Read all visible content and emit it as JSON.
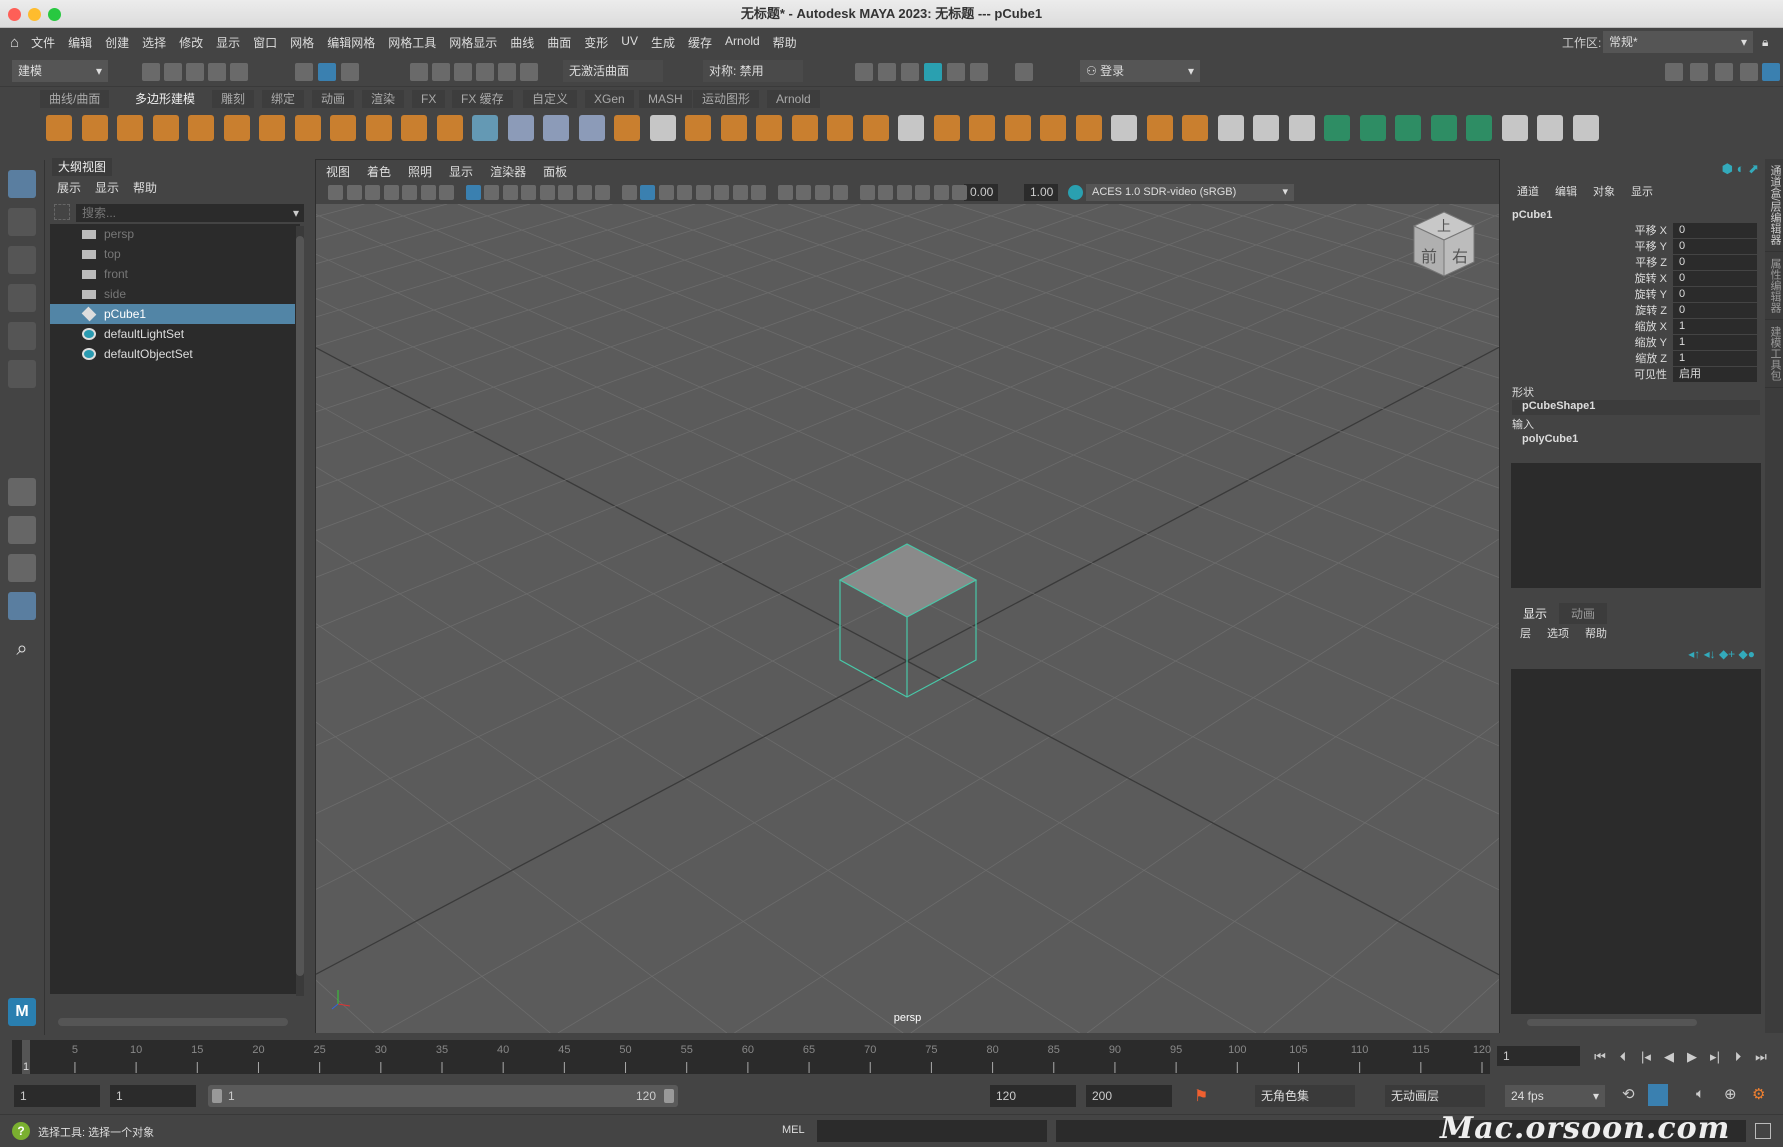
{
  "window": {
    "title": "无标题* - Autodesk MAYA 2023: 无标题   ---   pCube1"
  },
  "menubar": {
    "items": [
      "文件",
      "编辑",
      "创建",
      "选择",
      "修改",
      "显示",
      "窗口",
      "网格",
      "编辑网格",
      "网格工具",
      "网格显示",
      "曲线",
      "曲面",
      "变形",
      "UV",
      "生成",
      "缓存",
      "Arnold",
      "帮助"
    ],
    "workspace_label": "工作区:",
    "workspace_value": "常规*"
  },
  "toolbar": {
    "mode": "建模",
    "live_surface": "无激活曲面",
    "symmetry": "对称: 禁用",
    "login": "登录"
  },
  "shelf": {
    "tabs": [
      "曲线/曲面",
      "多边形建模",
      "雕刻",
      "绑定",
      "动画",
      "渲染",
      "FX",
      "FX 缓存",
      "自定义",
      "XGen",
      "MASH",
      "运动图形",
      "Arnold"
    ],
    "active_tab": 1,
    "icons": [
      [
        "poly-sphere-icon",
        "#e08a2c"
      ],
      [
        "poly-cube-icon",
        "#e08a2c"
      ],
      [
        "poly-cylinder-icon",
        "#e08a2c"
      ],
      [
        "poly-cone-icon",
        "#e08a2c"
      ],
      [
        "poly-torus-icon",
        "#e08a2c"
      ],
      [
        "poly-plane-icon",
        "#e08a2c"
      ],
      [
        "poly-disc-icon",
        "#e08a2c"
      ],
      [
        "platonic-icon",
        "#e08a2c"
      ],
      [
        "super-shape-icon",
        "#e08a2c"
      ],
      [
        "sweep-mesh-icon",
        "#e08a2c"
      ],
      [
        "text-icon",
        "#e08a2c"
      ],
      [
        "svg-icon",
        "#e08a2c"
      ],
      [
        "uv-editor-icon",
        "#6aa8c8"
      ],
      [
        "center-pivot-icon",
        "#9ac"
      ],
      [
        "delete-history-icon",
        "#9ac"
      ],
      [
        "freeze-transform-icon",
        "#9ac"
      ],
      [
        "boolean-icon",
        "#e08a2c"
      ],
      [
        "combine-icon",
        "#ddd"
      ],
      [
        "separate-icon",
        "#e08a2c"
      ],
      [
        "smooth-icon",
        "#e08a2c"
      ],
      [
        "reduce-icon",
        "#e08a2c"
      ],
      [
        "mirror-icon",
        "#e08a2c"
      ],
      [
        "extrude-icon",
        "#e08a2c"
      ],
      [
        "bevel-icon",
        "#e08a2c"
      ],
      [
        "bridge-icon",
        "#ddd"
      ],
      [
        "fill-hole-icon",
        "#e08a2c"
      ],
      [
        "append-icon",
        "#e08a2c"
      ],
      [
        "merge-icon",
        "#e08a2c"
      ],
      [
        "collapse-icon",
        "#e08a2c"
      ],
      [
        "target-weld-icon",
        "#e08a2c"
      ],
      [
        "extract-icon",
        "#ddd"
      ],
      [
        "poke-icon",
        "#e08a2c"
      ],
      [
        "wedge-icon",
        "#e08a2c"
      ],
      [
        "multicut-icon",
        "#ddd"
      ],
      [
        "loop-icon",
        "#ddd"
      ],
      [
        "edge-flow-icon",
        "#ddd"
      ],
      [
        "quad-draw-icon",
        "#2a9a6a"
      ],
      [
        "bend-icon",
        "#2a9a6a"
      ],
      [
        "slide-icon",
        "#2a9a6a"
      ],
      [
        "soft-select-icon",
        "#2a9a6a"
      ],
      [
        "tweak-icon",
        "#2a9a6a"
      ],
      [
        "uv-layout-icon",
        "#ddd"
      ],
      [
        "crease-icon",
        "#ddd"
      ],
      [
        "sculpt-icon",
        "#ddd"
      ]
    ]
  },
  "outliner": {
    "tab": "大纲视图",
    "menu": [
      "展示",
      "显示",
      "帮助"
    ],
    "search_placeholder": "搜索...",
    "items": [
      {
        "label": "persp",
        "icon": "camera-icon",
        "state": "dim"
      },
      {
        "label": "top",
        "icon": "camera-icon",
        "state": "dim"
      },
      {
        "label": "front",
        "icon": "camera-icon",
        "state": "dim"
      },
      {
        "label": "side",
        "icon": "camera-icon",
        "state": "dim"
      },
      {
        "label": "pCube1",
        "icon": "mesh-icon",
        "state": "sel"
      },
      {
        "label": "defaultLightSet",
        "icon": "set-icon",
        "state": ""
      },
      {
        "label": "defaultObjectSet",
        "icon": "set-icon",
        "state": ""
      }
    ]
  },
  "viewport": {
    "menu": [
      "视图",
      "着色",
      "照明",
      "显示",
      "渲染器",
      "面板"
    ],
    "exposure": "0.00",
    "gamma": "1.00",
    "color_space": "ACES 1.0 SDR-video (sRGB)",
    "camera_label": "persp",
    "viewcube": {
      "top": "上",
      "front": "前",
      "right": "右"
    },
    "accent": "#48c8a8"
  },
  "channelbox": {
    "menu": [
      "通道",
      "编辑",
      "对象",
      "显示"
    ],
    "object": "pCube1",
    "attrs": [
      [
        "平移 X",
        "0"
      ],
      [
        "平移 Y",
        "0"
      ],
      [
        "平移 Z",
        "0"
      ],
      [
        "旋转 X",
        "0"
      ],
      [
        "旋转 Y",
        "0"
      ],
      [
        "旋转 Z",
        "0"
      ],
      [
        "缩放 X",
        "1"
      ],
      [
        "缩放 Y",
        "1"
      ],
      [
        "缩放 Z",
        "1"
      ],
      [
        "可见性",
        "启用"
      ]
    ],
    "shapes_label": "形状",
    "shape": "pCubeShape1",
    "inputs_label": "输入",
    "input": "polyCube1"
  },
  "layers": {
    "tabs": [
      "显示",
      "动画"
    ],
    "menu": [
      "层",
      "选项",
      "帮助"
    ]
  },
  "side_tabs": [
    "通道盒/层编辑器",
    "属性编辑器",
    "建模工具包"
  ],
  "timeline": {
    "start": 1,
    "end": 120,
    "label_step": 5,
    "current_frame": "1"
  },
  "range": {
    "start": "1",
    "playback_start": "1",
    "slider_start": "1",
    "slider_end": "120",
    "playback_end": "120",
    "end": "200",
    "character_set": "无角色集",
    "anim_layer": "无动画层",
    "fps": "24 fps"
  },
  "status": {
    "help": "选择工具: 选择一个对象",
    "lang": "MEL",
    "watermark": "Mac.orsoon.com"
  }
}
